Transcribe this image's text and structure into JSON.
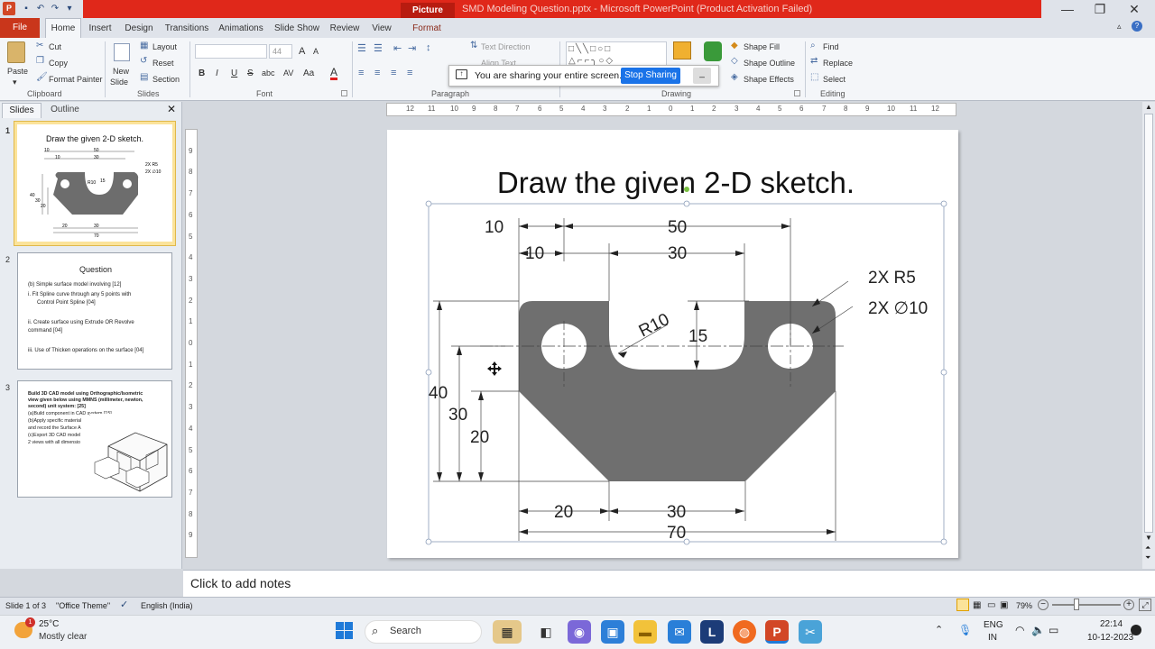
{
  "window": {
    "title": "SMD Modeling Question.pptx - Microsoft PowerPoint (Product Activation Failed)",
    "contextual_tab_group": "Picture Tools",
    "controls": {
      "minimize": "—",
      "maximize": "❐",
      "close": "✕"
    }
  },
  "ribbon_tabs": [
    "File",
    "Home",
    "Insert",
    "Design",
    "Transitions",
    "Animations",
    "Slide Show",
    "Review",
    "View",
    "Format"
  ],
  "ribbon": {
    "clipboard": {
      "paste": "Paste",
      "cut": "Cut",
      "copy": "Copy",
      "format_painter": "Format Painter",
      "group": "Clipboard"
    },
    "slides": {
      "new_slide_1": "New",
      "new_slide_2": "Slide",
      "layout": "Layout",
      "reset": "Reset",
      "section": "Section",
      "group": "Slides"
    },
    "font": {
      "size": "44",
      "bold": "B",
      "italic": "I",
      "underline": "U",
      "strike": "S",
      "shadow": "abc",
      "spacing": "AV",
      "case": "Aa",
      "color": "A",
      "grow": "A",
      "shrink": "A",
      "group": "Font"
    },
    "paragraph": {
      "text_direction": "Text Direction",
      "align_text": "Align Text",
      "group": "Paragraph"
    },
    "drawing": {
      "shape_fill": "Shape Fill",
      "shape_outline": "Shape Outline",
      "shape_effects": "Shape Effects",
      "group": "Drawing"
    },
    "editing": {
      "find": "Find",
      "replace": "Replace",
      "select": "Select",
      "group": "Editing"
    }
  },
  "share_banner": {
    "text": "You are sharing your entire screen.",
    "button": "Stop Sharing",
    "hide": "_"
  },
  "left_pane": {
    "tabs": [
      "Slides",
      "Outline"
    ],
    "close": "✕",
    "slides": [
      {
        "number": "1",
        "title": "Draw the given 2-D sketch."
      },
      {
        "number": "2",
        "title": "Question",
        "lines": [
          "(b)  Simple surface model involving [12]",
          "i.    Fit Spline curve through any 5 points with",
          "Control Point Spline [04]",
          "ii. Create surface using Extrude OR Revolve",
          "command [04]",
          "iii. Use of Thicken operations on the surface [04]"
        ]
      },
      {
        "number": "3",
        "lines": [
          "Build 3D CAD model using Orthographic/Isometric",
          "view given below using MMNS (millimeter, newton,",
          "second) unit system: [25]",
          "(a)Build component in CAD system [15]",
          "(b)Apply specific material",
          "and record the Surface A",
          "(c)Export 3D CAD model",
          "2 views with all dimensio"
        ]
      }
    ]
  },
  "ruler": {
    "h_ticks": [
      "12",
      "11",
      "10",
      "9",
      "8",
      "7",
      "6",
      "5",
      "4",
      "3",
      "2",
      "1",
      "0",
      "1",
      "2",
      "3",
      "4",
      "5",
      "6",
      "7",
      "8",
      "9",
      "10",
      "11",
      "12"
    ],
    "v_ticks": [
      "9",
      "8",
      "7",
      "6",
      "5",
      "4",
      "3",
      "2",
      "1",
      "0",
      "1",
      "2",
      "3",
      "4",
      "5",
      "6",
      "7",
      "8",
      "9"
    ]
  },
  "slide": {
    "title": "Draw the given 2-D sketch.",
    "dims": {
      "d10_top": "10",
      "d50": "50",
      "d10_inner": "10",
      "d30_top": "30",
      "d15": "15",
      "r10": "R10",
      "r5": "2X R5",
      "hole": "2X ∅10",
      "d40": "40",
      "d30_left": "30",
      "d20_left": "20",
      "d20_bottom": "20",
      "d30_bottom": "30",
      "d70": "70"
    }
  },
  "notes_placeholder": "Click to add notes",
  "status": {
    "slide": "Slide 1 of 3",
    "theme": "\"Office Theme\"",
    "language": "English (India)",
    "zoom": "79%"
  },
  "taskbar": {
    "temp": "25°C",
    "weather": "Mostly clear",
    "weather_badge": "1",
    "search": "Search",
    "lang1": "ENG",
    "lang2": "IN",
    "time": "22:14",
    "date": "10-12-2023"
  }
}
